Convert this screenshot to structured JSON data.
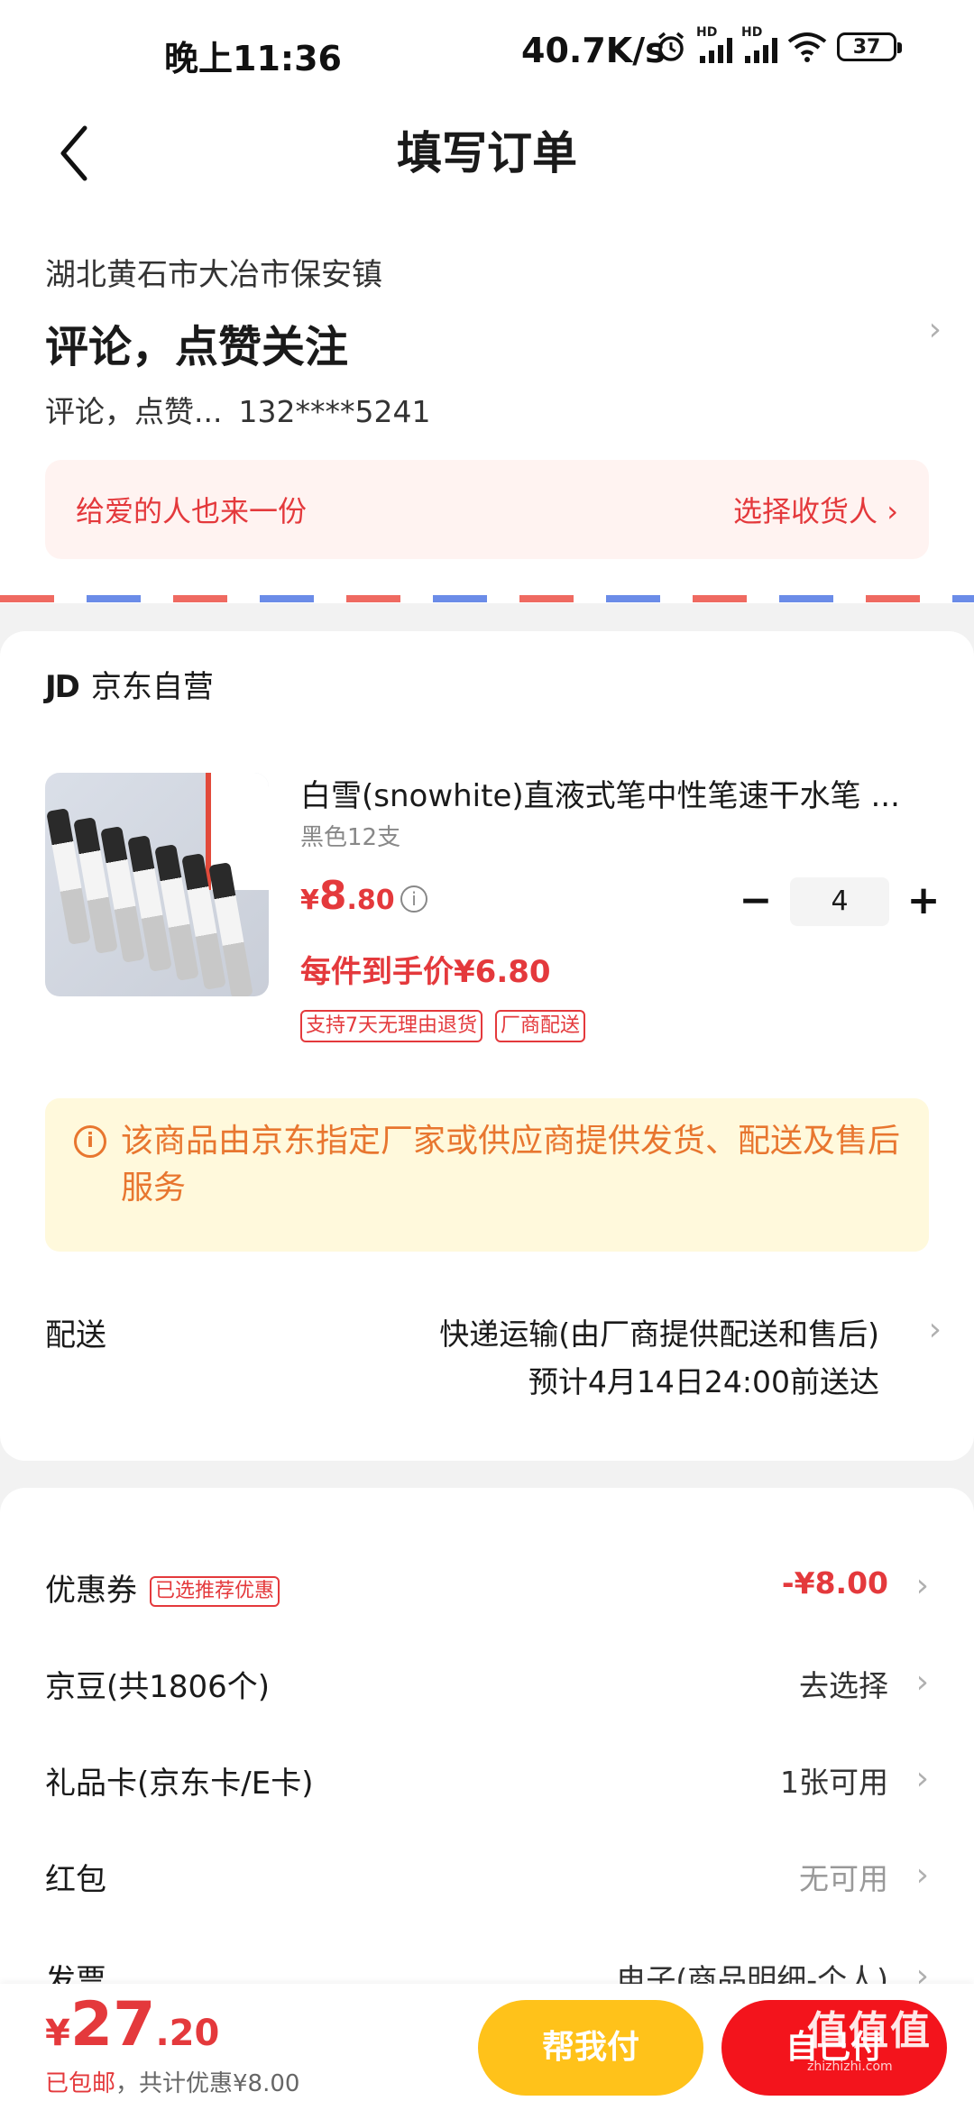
{
  "status_bar": {
    "time": "晚上11:36",
    "net_speed": "40.7K/s",
    "battery": "37"
  },
  "header": {
    "title": "填写订单"
  },
  "address": {
    "region": "湖北黄石市大冶市保安镇",
    "name": "评论，点赞关注",
    "contact_name": "评论，点赞...",
    "phone": "132****5241",
    "gift_left": "给爱的人也来一份",
    "gift_right": "选择收货人 ›"
  },
  "shop": {
    "logo": "JD",
    "name": "京东自营",
    "product": {
      "title": "白雪(snowhite)直液式笔中性笔速干水笔 ...",
      "spec": "黑色12支",
      "price_symbol": "¥",
      "price_int": "8",
      "price_dec": ".80",
      "unit_price": "每件到手价¥6.80",
      "tags": [
        "支持7天无理由退货",
        "厂商配送"
      ],
      "quantity": "4",
      "minus": "−",
      "plus": "+"
    },
    "notice": "该商品由京东指定厂家或供应商提供发货、配送及售后服务",
    "delivery_label": "配送",
    "delivery_method": "快递运输(由厂商提供配送和售后)",
    "delivery_eta": "预计4月14日24:00前送达"
  },
  "discounts": [
    {
      "label": "优惠券",
      "badge": "已选推荐优惠",
      "value": "-¥8.00",
      "color": "#e4393c"
    },
    {
      "label": "京豆(共1806个)",
      "value": "去选择",
      "color": "#333333"
    },
    {
      "label": "礼品卡(京东卡/E卡)",
      "value": "1张可用",
      "color": "#333333"
    },
    {
      "label": "红包",
      "value": "无可用",
      "color": "#999999"
    },
    {
      "label": "发票",
      "value": "电子(商品明细-个人)",
      "color": "#333333"
    }
  ],
  "bottom": {
    "symbol": "¥",
    "total_int": "27",
    "total_dec": ".20",
    "shipping": "已包邮",
    "discount_note": "，共计优惠¥8.00",
    "help_pay": "帮我付",
    "self_pay": "自己付",
    "watermark": "值值值",
    "watermark_url": "zhizhizhi.com"
  }
}
